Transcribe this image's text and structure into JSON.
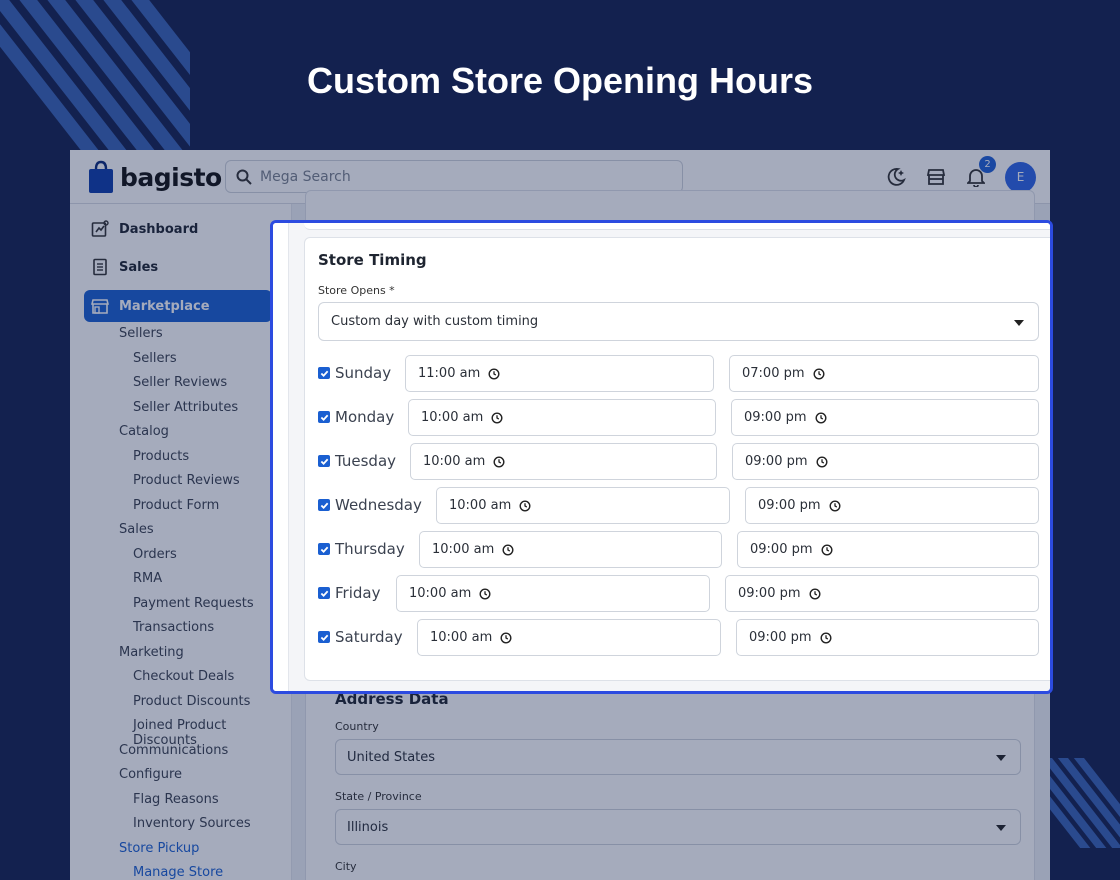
{
  "hero": {
    "title": "Custom Store Opening Hours"
  },
  "topbar": {
    "logo_text": "bagisto",
    "search_placeholder": "Mega Search",
    "notification_count": "2",
    "avatar_initial": "E"
  },
  "sidebar": {
    "dashboard": "Dashboard",
    "sales": "Sales",
    "marketplace": "Marketplace",
    "items": [
      {
        "label": "Sellers",
        "level": 1
      },
      {
        "label": "Sellers",
        "level": 2
      },
      {
        "label": "Seller Reviews",
        "level": 2
      },
      {
        "label": "Seller Attributes",
        "level": 2
      },
      {
        "label": "Catalog",
        "level": 1
      },
      {
        "label": "Products",
        "level": 2
      },
      {
        "label": "Product Reviews",
        "level": 2
      },
      {
        "label": "Product Form",
        "level": 2
      },
      {
        "label": "Sales",
        "level": 1
      },
      {
        "label": "Orders",
        "level": 2
      },
      {
        "label": "RMA",
        "level": 2
      },
      {
        "label": "Payment Requests",
        "level": 2
      },
      {
        "label": "Transactions",
        "level": 2
      },
      {
        "label": "Marketing",
        "level": 1
      },
      {
        "label": "Checkout Deals",
        "level": 2
      },
      {
        "label": "Product Discounts",
        "level": 2
      },
      {
        "label": "Joined Product Discounts",
        "level": 2
      },
      {
        "label": "Communications",
        "level": 1
      },
      {
        "label": "Configure",
        "level": 1
      },
      {
        "label": "Flag Reasons",
        "level": 2
      },
      {
        "label": "Inventory Sources",
        "level": 2
      },
      {
        "label": "Store Pickup",
        "level": 1
      },
      {
        "label": "Manage Store",
        "level": 2
      }
    ]
  },
  "store_timing": {
    "title": "Store Timing",
    "opens_label": "Store Opens *",
    "opens_value": "Custom day with custom timing",
    "days": [
      {
        "day": "Sunday",
        "open": "11:00 am",
        "close": "07:00 pm",
        "checked": true
      },
      {
        "day": "Monday",
        "open": "10:00 am",
        "close": "09:00 pm",
        "checked": true
      },
      {
        "day": "Tuesday",
        "open": "10:00 am",
        "close": "09:00 pm",
        "checked": true
      },
      {
        "day": "Wednesday",
        "open": "10:00 am",
        "close": "09:00 pm",
        "checked": true
      },
      {
        "day": "Thursday",
        "open": "10:00 am",
        "close": "09:00 pm",
        "checked": true
      },
      {
        "day": "Friday",
        "open": "10:00 am",
        "close": "09:00 pm",
        "checked": true
      },
      {
        "day": "Saturday",
        "open": "10:00 am",
        "close": "09:00 pm",
        "checked": true
      }
    ]
  },
  "address": {
    "title": "Address Data",
    "country_label": "Country",
    "country_value": "United States",
    "state_label": "State / Province",
    "state_value": "Illinois",
    "city_label": "City"
  },
  "colors": {
    "background": "#13214f",
    "accent": "#1a5fd1",
    "focus_border": "#2c4be0"
  }
}
